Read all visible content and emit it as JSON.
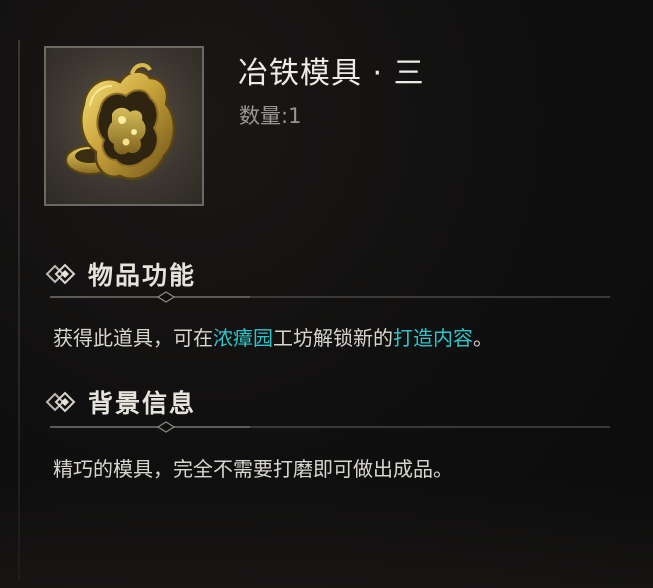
{
  "item": {
    "name": "冶铁模具 · 三",
    "quantity": "数量:1",
    "icon": "gold-mold-icon"
  },
  "sections": [
    {
      "title": "物品功能",
      "icon": "diamond-emblem-icon",
      "body": {
        "part1": "获得此道具，可在",
        "highlight1": "浓瘴园",
        "part2": "工坊解锁新的",
        "highlight2": "打造内容",
        "part3": "。"
      }
    },
    {
      "title": "背景信息",
      "icon": "diamond-emblem-icon",
      "body": {
        "text": "精巧的模具，完全不需要打磨即可做出成品。"
      }
    }
  ],
  "colors": {
    "highlight": "#2fc4c8",
    "title": "#ecebe6",
    "muted": "#9a968f",
    "background": "#111010"
  }
}
